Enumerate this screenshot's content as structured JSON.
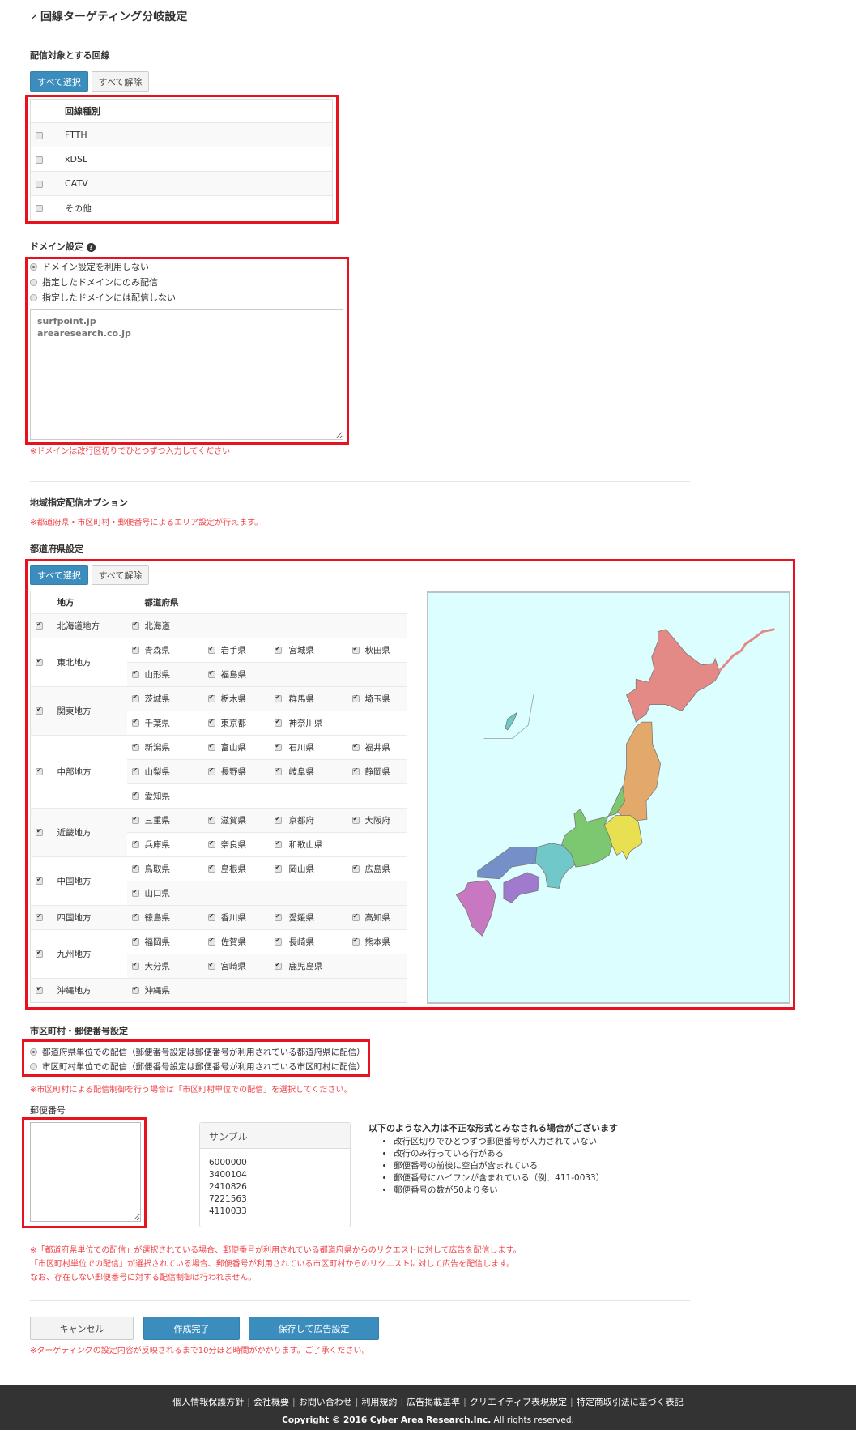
{
  "page_title": "回線ターゲティング分岐設定",
  "line_section": {
    "label": "配信対象とする回線",
    "select_all": "すべて選択",
    "clear_all": "すべて解除",
    "column_header": "回線種別",
    "items": [
      {
        "label": "FTTH",
        "checked": false
      },
      {
        "label": "xDSL",
        "checked": false
      },
      {
        "label": "CATV",
        "checked": false
      },
      {
        "label": "その他",
        "checked": false
      }
    ]
  },
  "domain_section": {
    "label": "ドメイン設定",
    "options": [
      {
        "label": "ドメイン設定を利用しない",
        "selected": true
      },
      {
        "label": "指定したドメインにのみ配信",
        "selected": false
      },
      {
        "label": "指定したドメインには配信しない",
        "selected": false
      }
    ],
    "placeholder": "surfpoint.jp\narearesearch.co.jp",
    "note": "※ドメインは改行区切りでひとつずつ入力してください"
  },
  "area_section": {
    "label": "地域指定配信オプション",
    "note": "※都道府県・市区町村・郵便番号によるエリア設定が行えます。"
  },
  "pref_section": {
    "label": "都道府県設定",
    "select_all": "すべて選択",
    "clear_all": "すべて解除",
    "col_region": "地方",
    "col_pref": "都道府県",
    "regions": [
      {
        "name": "北海道地方",
        "prefs": [
          "北海道"
        ]
      },
      {
        "name": "東北地方",
        "prefs": [
          "青森県",
          "岩手県",
          "宮城県",
          "秋田県",
          "山形県",
          "福島県"
        ]
      },
      {
        "name": "関東地方",
        "prefs": [
          "茨城県",
          "栃木県",
          "群馬県",
          "埼玉県",
          "千葉県",
          "東京都",
          "神奈川県"
        ]
      },
      {
        "name": "中部地方",
        "prefs": [
          "新潟県",
          "富山県",
          "石川県",
          "福井県",
          "山梨県",
          "長野県",
          "岐阜県",
          "静岡県",
          "愛知県"
        ]
      },
      {
        "name": "近畿地方",
        "prefs": [
          "三重県",
          "滋賀県",
          "京都府",
          "大阪府",
          "兵庫県",
          "奈良県",
          "和歌山県"
        ]
      },
      {
        "name": "中国地方",
        "prefs": [
          "鳥取県",
          "島根県",
          "岡山県",
          "広島県",
          "山口県"
        ]
      },
      {
        "name": "四国地方",
        "prefs": [
          "徳島県",
          "香川県",
          "愛媛県",
          "高知県"
        ]
      },
      {
        "name": "九州地方",
        "prefs": [
          "福岡県",
          "佐賀県",
          "長崎県",
          "熊本県",
          "大分県",
          "宮崎県",
          "鹿児島県"
        ]
      },
      {
        "name": "沖縄地方",
        "prefs": [
          "沖縄県"
        ]
      }
    ],
    "map_colors": {
      "hokkaido": "#e38a87",
      "tohoku": "#e3a96b",
      "kanto": "#e8e050",
      "chubu": "#7cc870",
      "kinki": "#70c8c8",
      "chugoku": "#7590c8",
      "shikoku": "#a07acc",
      "kyushu": "#c878c0",
      "sea": "#ddfefe"
    }
  },
  "city_section": {
    "label": "市区町村・郵便番号設定",
    "options": [
      {
        "label": "都道府県単位での配信（郵便番号設定は郵便番号が利用されている都道府県に配信）",
        "selected": true
      },
      {
        "label": "市区町村単位での配信（郵便番号設定は郵便番号が利用されている市区町村に配信）",
        "selected": false
      }
    ],
    "note": "※市区町村による配信制御を行う場合は「市区町村単位での配信」を選択してください。"
  },
  "postal_section": {
    "label": "郵便番号",
    "value": "",
    "sample_title": "サンプル",
    "samples": [
      "6000000",
      "3400104",
      "2410826",
      "7221563",
      "4110033"
    ],
    "rules_title": "以下のような入力は不正な形式とみなされる場合がございます",
    "rules": [
      "改行区切りでひとつずつ郵便番号が入力されていない",
      "改行のみ行っている行がある",
      "郵便番号の前後に空白が含まれている",
      "郵便番号にハイフンが含まれている（例．411-0033）",
      "郵便番号の数が50より多い"
    ],
    "notes": [
      "※「都道府県単位での配信」が選択されている場合、郵便番号が利用されている都道府県からのリクエストに対して広告を配信します。",
      "「市区町村単位での配信」が選択されている場合、郵便番号が利用されている市区町村からのリクエストに対して広告を配信します。",
      "なお、存在しない郵便番号に対する配信制御は行われません。"
    ]
  },
  "actions": {
    "cancel": "キャンセル",
    "complete": "作成完了",
    "save_ad": "保存して広告設定",
    "note": "※ターゲティングの設定内容が反映されるまで10分ほど時間がかかります。ご了承ください。"
  },
  "footer": {
    "links": [
      "個人情報保護方針",
      "会社概要",
      "お問い合わせ",
      "利用規約",
      "広告掲載基準",
      "クリエイティブ表現規定",
      "特定商取引法に基づく表記"
    ],
    "copyright_bold": "Copyright © 2016 Cyber Area Research.Inc.",
    "copyright_rest": " All rights reserved."
  }
}
